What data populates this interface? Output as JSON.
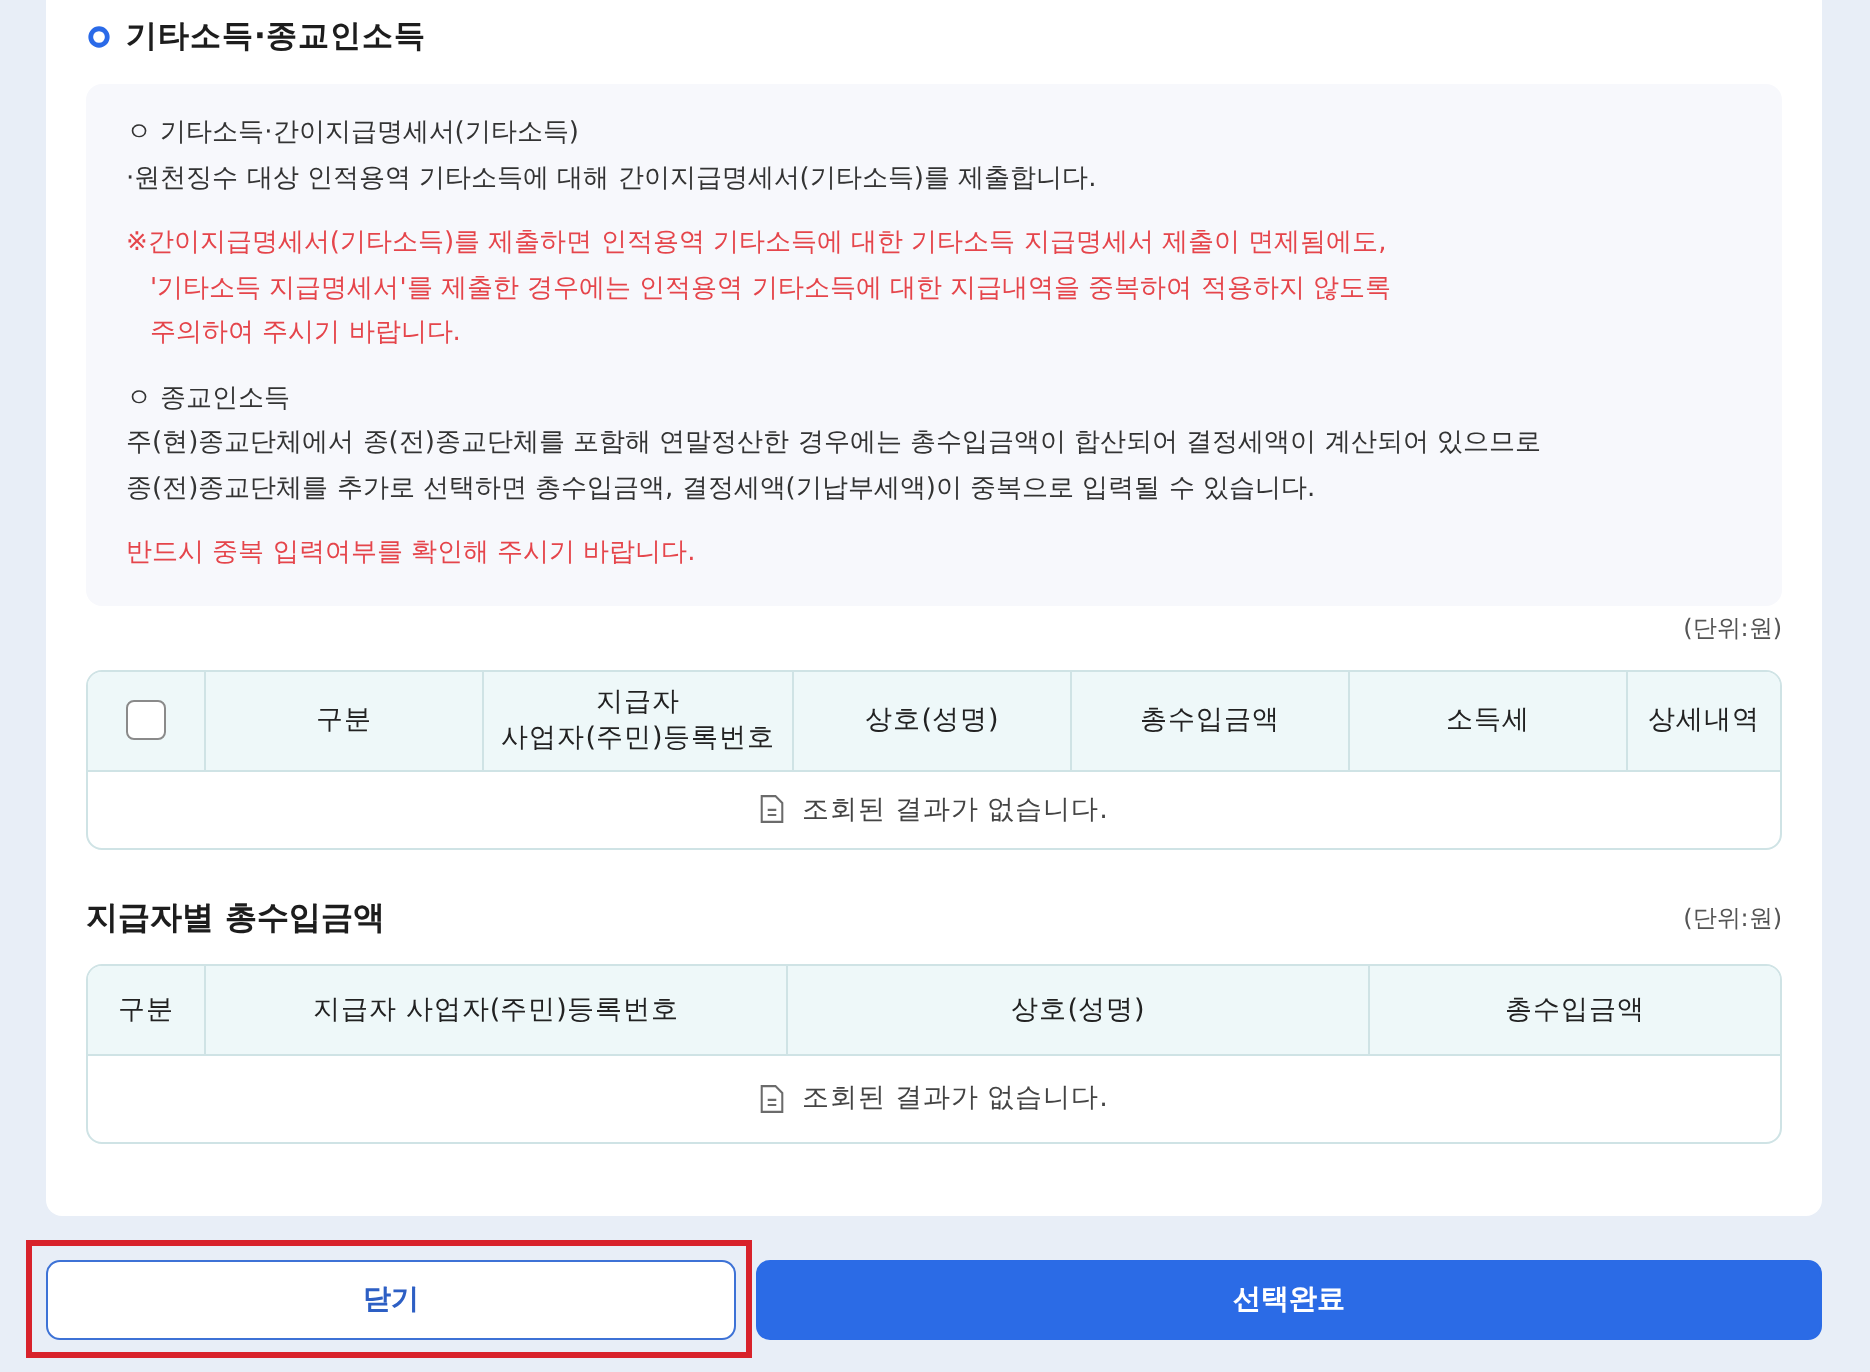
{
  "section": {
    "title": "기타소득·종교인소득"
  },
  "notice": {
    "blocks": [
      {
        "kind": "subheading",
        "lines": [
          "ㅇ 기타소득·간이지급명세서(기타소득)"
        ]
      },
      {
        "kind": "text",
        "lines": [
          "·원천징수 대상 인적용역 기타소득에 대해 간이지급명세서(기타소득)를 제출합니다."
        ]
      },
      {
        "kind": "warning",
        "lines": [
          "※간이지급명세서(기타소득)를 제출하면 인적용역 기타소득에 대한 기타소득 지급명세서 제출이 면제됨에도,",
          "'기타소득 지급명세서'를 제출한 경우에는 인적용역 기타소득에 대한 지급내역을 중복하여 적용하지 않도록",
          "주의하여 주시기 바랍니다."
        ]
      },
      {
        "kind": "subheading",
        "lines": [
          "ㅇ 종교인소득"
        ]
      },
      {
        "kind": "text",
        "lines": [
          "주(현)종교단체에서 종(전)종교단체를 포함해 연말정산한 경우에는 총수입금액이 합산되어 결정세액이 계산되어 있으므로",
          "종(전)종교단체를 추가로 선택하면 총수입금액, 결정세액(기납부세액)이 중복으로 입력될 수 있습니다."
        ]
      },
      {
        "kind": "warning",
        "lines": [
          "반드시 중복 입력여부를 확인해 주시기 바랍니다."
        ]
      }
    ]
  },
  "income_table": {
    "unit": "(단위:원)",
    "select_all": {
      "checked": false
    },
    "columns": [
      "구분",
      "지급자\n사업자(주민)등록번호",
      "상호(성명)",
      "총수입금액",
      "소득세",
      "상세내역"
    ],
    "empty_message": "조회된 결과가 없습니다."
  },
  "payer_totals": {
    "title": "지급자별 총수입금액",
    "unit": "(단위:원)",
    "columns": [
      "구분",
      "지급자 사업자(주민)등록번호",
      "상호(성명)",
      "총수입금액"
    ],
    "empty_message": "조회된 결과가 없습니다."
  },
  "buttons": [
    {
      "label": "닫기",
      "kind": "secondary",
      "highlighted": true
    },
    {
      "label": "선택완료",
      "kind": "primary",
      "highlighted": false
    }
  ]
}
